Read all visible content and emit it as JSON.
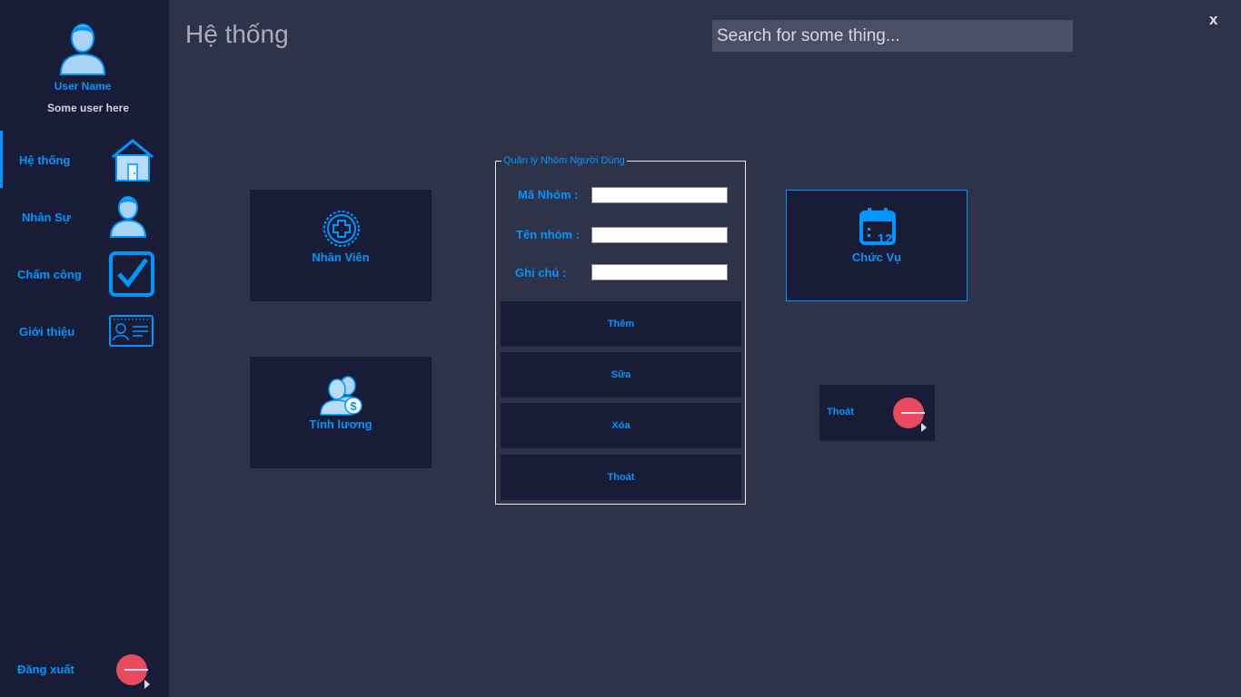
{
  "sidebar": {
    "user_name": "User Name",
    "user_sub": "Some user here",
    "items": [
      {
        "label": "Hệ thống",
        "icon": "home-icon"
      },
      {
        "label": "Nhân Sự",
        "icon": "person-icon"
      },
      {
        "label": "Chấm công",
        "icon": "checkbox-icon"
      },
      {
        "label": "Giới thiệu",
        "icon": "id-card-icon"
      }
    ],
    "logout_label": "Đăng xuất"
  },
  "header": {
    "title": "Hệ thống",
    "search_placeholder": "Search for some thing...",
    "close_label": "x"
  },
  "tiles": {
    "employee": "Nhân Viên",
    "salary": "Tính lương",
    "position": "Chức Vụ"
  },
  "group_form": {
    "legend": "Quản lý Nhóm Người Dùng",
    "fields": [
      {
        "label": "Mã Nhóm :",
        "value": ""
      },
      {
        "label": "Tên nhóm :",
        "value": ""
      },
      {
        "label": "Ghi chú :",
        "value": ""
      }
    ],
    "buttons": [
      "Thêm",
      "Sữa",
      "Xóa",
      "Thoát"
    ]
  },
  "exit_tile": {
    "label": "Thoát"
  },
  "colors": {
    "accent": "#0096ff",
    "background": "#2e3349",
    "panel": "#181c37",
    "exit": "#ea4a5f"
  }
}
